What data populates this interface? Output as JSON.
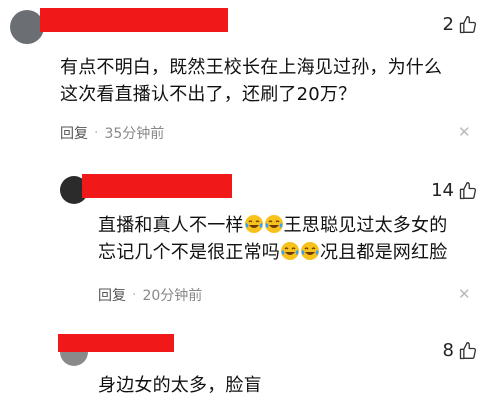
{
  "comments": [
    {
      "likes": "2",
      "text_line1": "有点不明白，既然王校长在上海见过孙，为什么",
      "text_line2": "这次看直播认不出了，还刷了20万？",
      "reply_label": "回复",
      "separator": "·",
      "time": "35分钟前"
    },
    {
      "likes": "14",
      "text_line1_a": "直播和真人不一样",
      "text_line1_b": "王思聪见过太多女的",
      "text_line2_a": "忘记几个不是很正常吗",
      "text_line2_b": "况且都是网红脸",
      "reply_label": "回复",
      "separator": "·",
      "time": "20分钟前"
    },
    {
      "likes": "8",
      "text": "身边女的太多，脸盲"
    }
  ],
  "icons": {
    "like": "thumbs-up-icon",
    "close": "close-icon",
    "emoji": "laughing-tears-emoji"
  },
  "colors": {
    "redaction": "#f01818",
    "meta_text": "#888888",
    "emoji_face": "#f7c21b"
  }
}
